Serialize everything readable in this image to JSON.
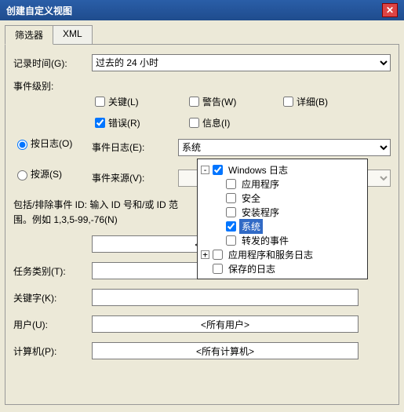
{
  "title": "创建自定义视图",
  "tabs": {
    "filter": "筛选器",
    "xml": "XML"
  },
  "labels": {
    "logged": "记录时间(G):",
    "level": "事件级别:",
    "byLog": "按日志(O)",
    "bySource": "按源(S)",
    "eventLogs": "事件日志(E):",
    "eventSources": "事件来源(V):",
    "note": "包括/排除事件 ID: 输入 ID 号和/或 ID 范围。例如 1,3,5-99,-76(N)",
    "taskCat": "任务类别(T):",
    "keywords": "关键字(K):",
    "user": "用户(U):",
    "computer": "计算机(P):"
  },
  "loggedValue": "过去的 24 小时",
  "levels": {
    "critical": "关键(L)",
    "warning": "警告(W)",
    "verbose": "详细(B)",
    "error": "错误(R)",
    "info": "信息(I)"
  },
  "eventLogsValue": "系统",
  "placeholders": {
    "allIds": "<所有事件 ID>",
    "allUsers": "<所有用户>",
    "allComputers": "<所有计算机>"
  },
  "tree": {
    "winLogs": "Windows 日志",
    "app": "应用程序",
    "security": "安全",
    "setup": "安装程序",
    "system": "系统",
    "forwarded": "转发的事件",
    "appServices": "应用程序和服务日志",
    "saved": "保存的日志"
  }
}
